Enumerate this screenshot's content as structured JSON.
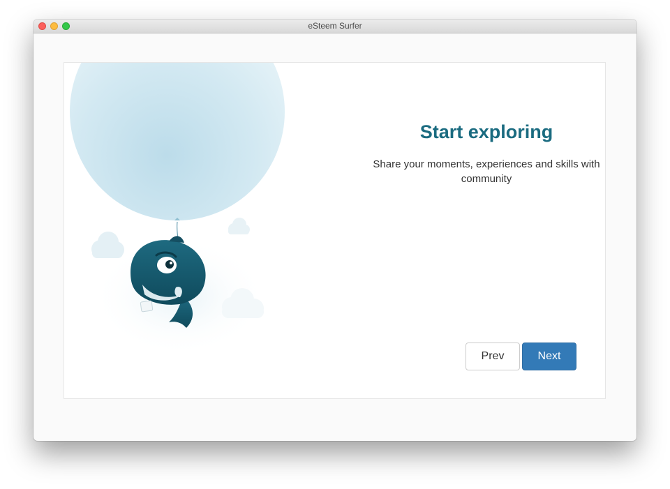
{
  "window": {
    "title": "eSteem Surfer"
  },
  "onboarding": {
    "heading": "Start exploring",
    "description": "Share your moments, experiences and skills with community",
    "prev_label": "Prev",
    "next_label": "Next"
  },
  "colors": {
    "heading": "#1a6b80",
    "primary_button": "#337ab7",
    "balloon": "#cfe6f0",
    "mascot": "#1b5f73"
  }
}
